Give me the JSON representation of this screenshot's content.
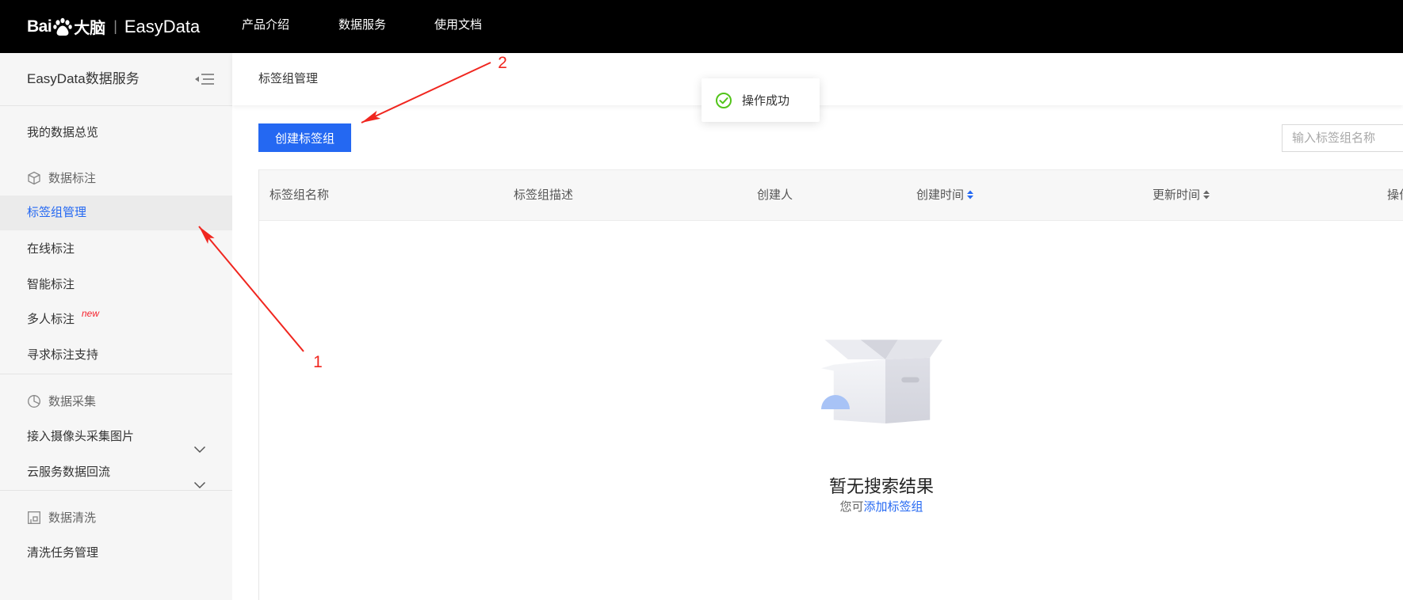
{
  "topbar": {
    "logo": {
      "brand_prefix": "Bai",
      "brand_suffix": "大脑",
      "divider": "|",
      "product": "EasyData",
      "icon": "paw-icon"
    },
    "nav": [
      {
        "label": "产品介绍"
      },
      {
        "label": "数据服务"
      },
      {
        "label": "使用文档"
      }
    ]
  },
  "sidebar": {
    "title": "EasyData数据服务",
    "collapse_icon": "collapse-menu-icon",
    "overview": {
      "label": "我的数据总览"
    },
    "groups": [
      {
        "title": "数据标注",
        "icon": "cube-icon",
        "items": [
          {
            "label": "标签组管理",
            "active": true
          },
          {
            "label": "在线标注"
          },
          {
            "label": "智能标注"
          },
          {
            "label": "多人标注",
            "badge": "new"
          },
          {
            "label": "寻求标注支持"
          }
        ]
      },
      {
        "title": "数据采集",
        "icon": "pie-chart-icon",
        "items": [
          {
            "label": "接入摄像头采集图片",
            "expandable": true,
            "expand_icon": "chevron-down-icon"
          },
          {
            "label": "云服务数据回流",
            "expandable": true,
            "expand_icon": "chevron-down-icon"
          }
        ]
      },
      {
        "title": "数据清洗",
        "icon": "image-clean-icon",
        "items": [
          {
            "label": "清洗任务管理"
          }
        ]
      }
    ]
  },
  "main": {
    "breadcrumb": "标签组管理",
    "create_button": "创建标签组",
    "search": {
      "placeholder": "输入标签组名称",
      "value": ""
    },
    "table": {
      "columns": [
        {
          "label": "标签组名称"
        },
        {
          "label": "标签组描述"
        },
        {
          "label": "创建人"
        },
        {
          "label": "创建时间",
          "sortable": true,
          "sort_icon": "sort-icon"
        },
        {
          "label": "更新时间",
          "sortable": true,
          "sort_icon": "sort-icon"
        },
        {
          "label": "操作"
        }
      ],
      "rows": []
    },
    "empty_state": {
      "icon": "empty-box-icon",
      "title": "暂无搜索结果",
      "hint_prefix": "您可",
      "hint_link": "添加标签组"
    }
  },
  "toast": {
    "icon": "check-circle-icon",
    "message": "操作成功"
  },
  "annotations": [
    {
      "label": "1"
    },
    {
      "label": "2"
    }
  ],
  "colors": {
    "topbar_bg": "#000000",
    "accent": "#2468f2",
    "success": "#52c41a",
    "annotation": "#f0261f",
    "sidebar_bg": "#f6f6f6"
  }
}
